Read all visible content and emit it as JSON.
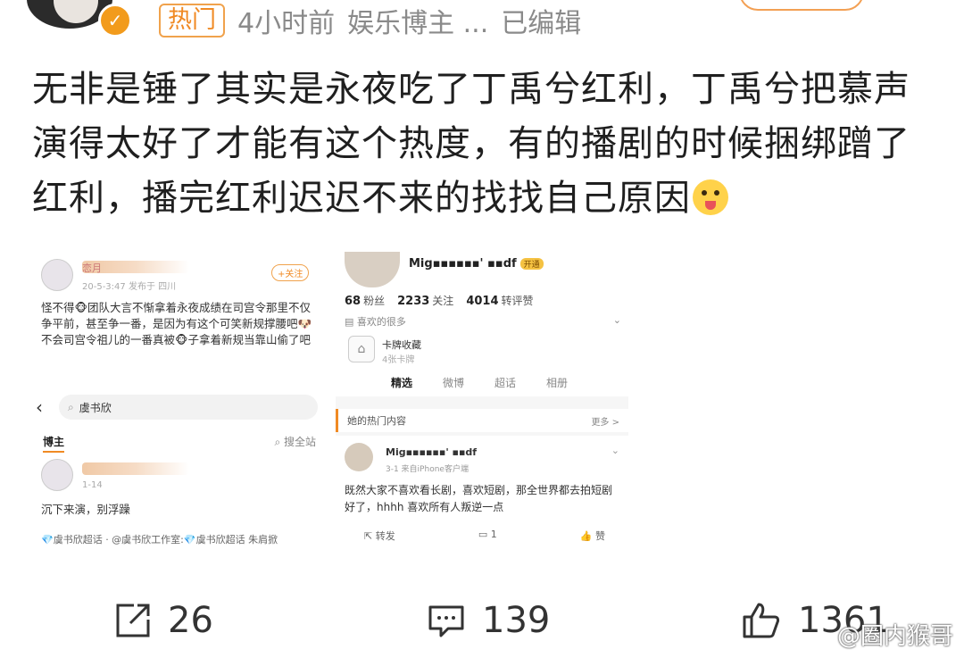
{
  "header": {
    "hot_tag": "热门",
    "time": "4小时前",
    "author_desc": "娱乐博主 ...",
    "edited": "已编辑"
  },
  "post": {
    "text": "无非是锤了其实是永夜吃了丁禹兮红利，丁禹兮把慕声演得太好了才能有这个热度，有的播剧的时候捆绑蹭了红利，播完红利迟迟不来的找找自己原因"
  },
  "left_shot": {
    "name_fragment": "恋月",
    "time": "20-5-3:47 发布于 四川",
    "follow": "+关注",
    "body": "怪不得🐵团队大言不惭拿着永夜成绩在司宫令那里不仅争平前，甚至争一番，是因为有这个可笑新规撑腰吧🐶\n不会司宫令祖儿的一番真被🐵子拿着新规当靠山偷了吧",
    "search_text": "虞书欣",
    "tab_active": "博主",
    "tab_right": "搜全站",
    "reply_name": "恋月",
    "reply_date": "1-14",
    "reply_text": "沉下来演，别浮躁",
    "tags": "💎虞书欣超话 · @虞书欣工作室:💎虞书欣超话 朱肩掀"
  },
  "right_shot": {
    "name": "Mig▪▪▪▪▪▪' ▪▪df",
    "vip": "开通",
    "fans_count": "68",
    "fans_label": "粉丝",
    "following_count": "2233",
    "following_label": "关注",
    "likes_count": "4014",
    "likes_label": "转评赞",
    "likes_row": "喜欢的很多",
    "card_title": "卡牌收藏",
    "card_sub": "4张卡牌",
    "tabs": [
      "精选",
      "微博",
      "超话",
      "相册"
    ],
    "hot_title": "她的热门内容",
    "more": "更多 >",
    "post_name": "Mig▪▪▪▪▪▪' ▪▪df",
    "post_sub": "3-1  来自iPhone客户端",
    "post_text": "既然大家不喜欢看长剧，喜欢短剧，那全世界都去拍短剧好了，hhhh 喜欢所有人叛逆一点",
    "repost": "转发",
    "comment": "1",
    "like": "赞"
  },
  "actions": {
    "repost_count": "26",
    "comment_count": "139",
    "like_count": "1361"
  },
  "watermark": "@圈内猴哥",
  "colors": {
    "accent": "#f08a24",
    "verified": "#f29b1c"
  }
}
